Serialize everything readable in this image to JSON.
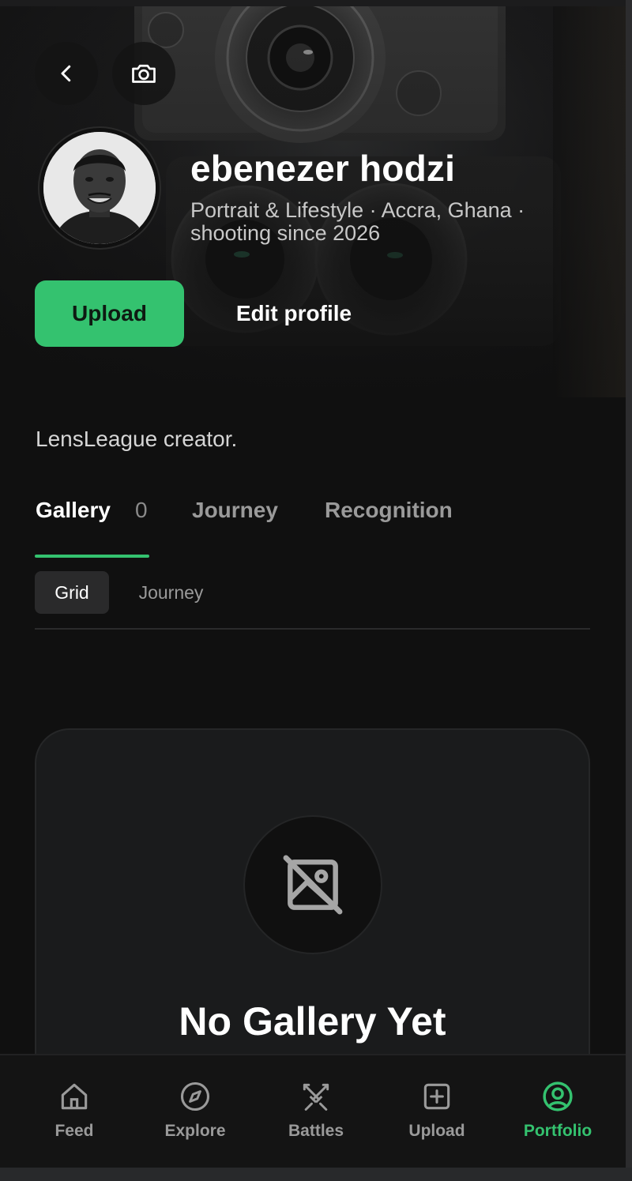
{
  "profile": {
    "name": "ebenezer hodzi",
    "subtitle": "Portrait & Lifestyle · Accra, Ghana · shooting since 2026",
    "bio": "LensLeague creator."
  },
  "actions": {
    "upload_label": "Upload",
    "edit_label": "Edit profile"
  },
  "tabs": [
    {
      "label": "Gallery",
      "count": "0",
      "active": true
    },
    {
      "label": "Journey",
      "active": false
    },
    {
      "label": "Recognition",
      "active": false
    }
  ],
  "view_toggle": {
    "options": [
      "Grid",
      "Journey"
    ],
    "selected": "Grid"
  },
  "empty_state": {
    "title": "No Gallery Yet",
    "icon": "image-off-icon"
  },
  "bottom_nav": [
    {
      "label": "Feed",
      "icon": "home-icon",
      "active": false
    },
    {
      "label": "Explore",
      "icon": "compass-icon",
      "active": false
    },
    {
      "label": "Battles",
      "icon": "crossed-swords-icon",
      "active": false
    },
    {
      "label": "Upload",
      "icon": "plus-square-icon",
      "active": false
    },
    {
      "label": "Portfolio",
      "icon": "user-circle-icon",
      "active": true
    }
  ],
  "colors": {
    "accent": "#34c26f",
    "background": "#101010",
    "card": "#1a1b1c",
    "muted_text": "#9a9a9a"
  }
}
